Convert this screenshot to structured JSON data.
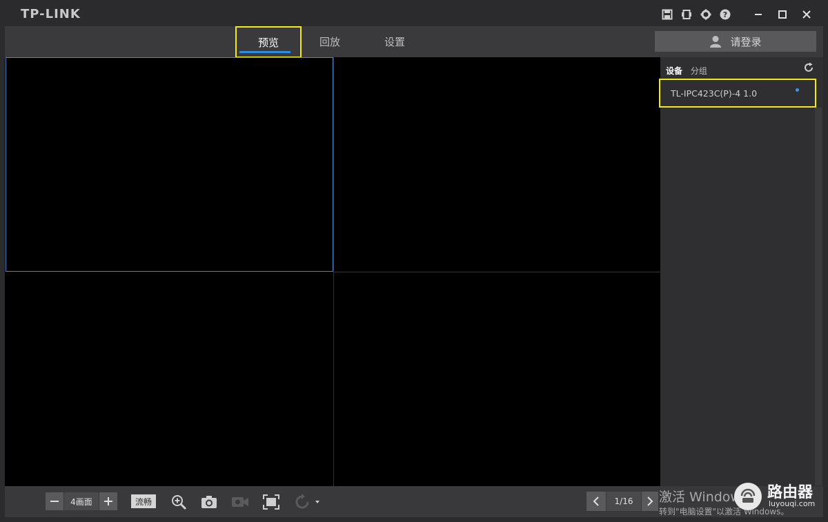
{
  "app": {
    "logo": "TP-LINK"
  },
  "titlebar": {
    "icons": [
      "save-icon",
      "device-icon",
      "gear-icon",
      "help-icon"
    ],
    "window_controls": [
      "minimize-icon",
      "maximize-icon",
      "close-icon"
    ]
  },
  "nav": {
    "tabs": [
      {
        "label": "预览",
        "active": true
      },
      {
        "label": "回放",
        "active": false
      },
      {
        "label": "设置",
        "active": false
      }
    ],
    "accent": "#2a8ee8"
  },
  "login": {
    "label": "请登录",
    "icon": "user-icon"
  },
  "sidebar": {
    "tabs": [
      {
        "label": "设备",
        "active": true
      },
      {
        "label": "分组",
        "active": false
      }
    ],
    "refresh_icon": "refresh-icon",
    "devices": [
      {
        "name": "TL-IPC423C(P)-4 1.0",
        "status_color": "#3a96ee"
      }
    ]
  },
  "toolbar": {
    "layout_label": "4画面",
    "stream_label": "流畅",
    "icons": [
      "zoom-in-icon",
      "camera-icon",
      "record-icon",
      "fullscreen-icon",
      "rotate-icon"
    ],
    "page": "1/16"
  },
  "watermark": {
    "line1": "激活 Window",
    "line2": "转到\"电脑设置\"以激活 Windows。"
  },
  "brand_badge": {
    "line1": "路由器",
    "line2": "luyouqi.com"
  },
  "colors": {
    "highlight": "#f2ea1a",
    "selected_pane_border": "#4d86c7"
  }
}
